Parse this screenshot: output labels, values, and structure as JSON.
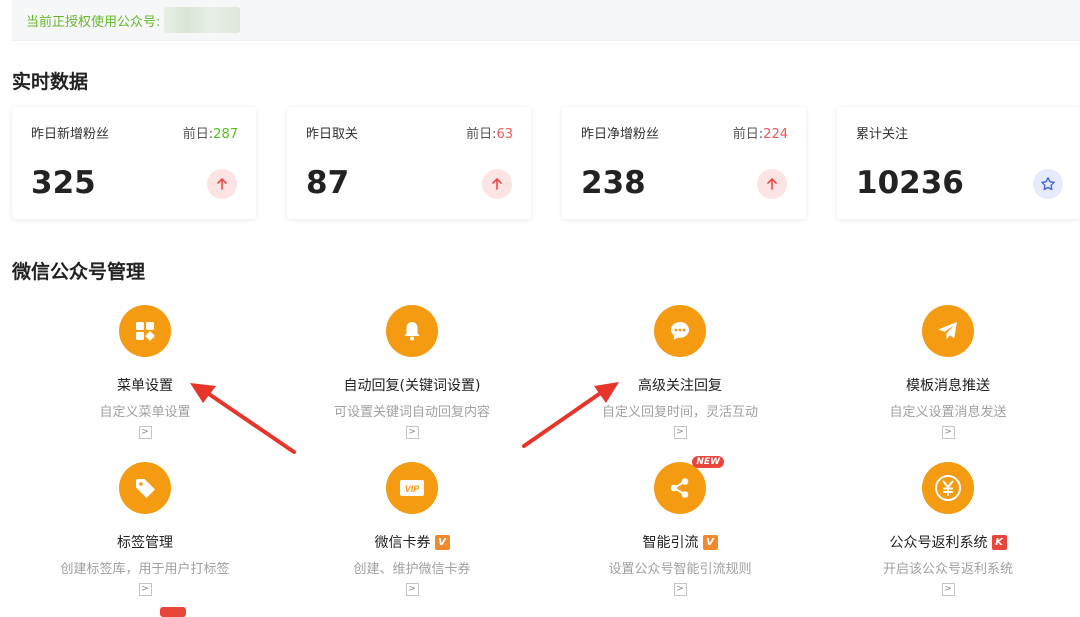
{
  "auth": {
    "label": "当前正授权使用公众号:"
  },
  "realtime": {
    "title": "实时数据",
    "cards": [
      {
        "title": "昨日新增粉丝",
        "prev_label": "前日:",
        "prev_value": "287",
        "value": "325",
        "trend_icon": "arrow-up-icon"
      },
      {
        "title": "昨日取关",
        "prev_label": "前日:",
        "prev_value": "63",
        "value": "87",
        "trend_icon": "arrow-up-icon"
      },
      {
        "title": "昨日净增粉丝",
        "prev_label": "前日:",
        "prev_value": "224",
        "value": "238",
        "trend_icon": "arrow-up-icon"
      },
      {
        "title": "累计关注",
        "value": "10236",
        "trend_icon": "star-icon"
      }
    ]
  },
  "management": {
    "title": "微信公众号管理",
    "features": [
      {
        "name": "菜单设置",
        "desc": "自定义菜单设置",
        "icon": "grid-icon"
      },
      {
        "name": "自动回复(关键词设置)",
        "desc": "可设置关键词自动回复内容",
        "icon": "bell-icon"
      },
      {
        "name": "高级关注回复",
        "desc": "自定义回复时间，灵活互动",
        "icon": "chat-bubble-icon"
      },
      {
        "name": "模板消息推送",
        "desc": "自定义设置消息发送",
        "icon": "paper-plane-icon"
      },
      {
        "name": "标签管理",
        "desc": "创建标签库，用于用户打标签",
        "icon": "tag-icon"
      },
      {
        "name": "微信卡券",
        "desc": "创建、维护微信卡券",
        "icon": "vip-card-icon",
        "vip_tag": "V"
      },
      {
        "name": "智能引流",
        "desc": "设置公众号智能引流规则",
        "icon": "share-icon",
        "vip_tag": "V",
        "new_tag": "NEW"
      },
      {
        "name": "公众号返利系统",
        "desc": "开启该公众号返利系统",
        "icon": "yen-coin-icon",
        "vip_tag": "K"
      }
    ],
    "go_glyph": ">"
  },
  "colors": {
    "accent_orange": "#f49b12",
    "green": "#52c41a",
    "red": "#ee5a5a",
    "blue": "#3f63d6"
  }
}
